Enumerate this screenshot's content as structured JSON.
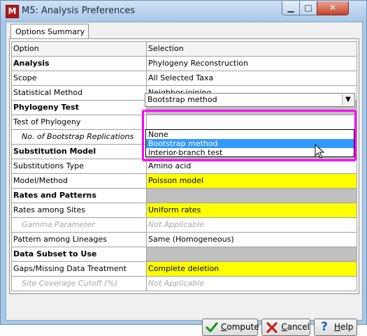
{
  "window": {
    "title": "M5: Analysis Preferences",
    "icon_letter": "M",
    "minimize_glyph": "▁",
    "maximize_glyph": "□",
    "close_glyph": "✕"
  },
  "tab": {
    "label": "Options Summary"
  },
  "table": {
    "headers": {
      "option": "Option",
      "selection": "Selection"
    },
    "rows": [
      {
        "option": "Analysis",
        "selection": "Phylogeny Reconstruction",
        "style": "section-bold"
      },
      {
        "option": "Scope",
        "selection": "All Selected Taxa",
        "style": "normal"
      },
      {
        "option": "Statistical Method",
        "selection": "Neighbor-joining",
        "style": "normal"
      },
      {
        "option": "Phylogeny Test",
        "selection": "",
        "style": "section"
      },
      {
        "option": "Test of Phylogeny",
        "selection": "Bootstrap method",
        "style": "combo"
      },
      {
        "option": "No. of Bootstrap Replications",
        "selection": "",
        "style": "sub"
      },
      {
        "option": "Substitution Model",
        "selection": "",
        "style": "section"
      },
      {
        "option": "Substitutions Type",
        "selection": "Amino acid",
        "style": "normal"
      },
      {
        "option": "Model/Method",
        "selection": "Poisson model",
        "style": "yellow"
      },
      {
        "option": "Rates and Patterns",
        "selection": "",
        "style": "section"
      },
      {
        "option": "Rates among Sites",
        "selection": "Uniform rates",
        "style": "yellow"
      },
      {
        "option": "Gamma Parameter",
        "selection": "Not Applicable",
        "style": "disabled"
      },
      {
        "option": "Pattern among Lineages",
        "selection": "Same (Homogeneous)",
        "style": "normal"
      },
      {
        "option": "Data Subset to Use",
        "selection": "",
        "style": "section"
      },
      {
        "option": "Gaps/Missing Data Treatment",
        "selection": "Complete deletion",
        "style": "yellow"
      },
      {
        "option": "Site Coverage Cutoff (%)",
        "selection": "Not Applicable",
        "style": "disabled"
      }
    ]
  },
  "combo": {
    "value": "Bootstrap method",
    "options": [
      "None",
      "Bootstrap method",
      "Interior-branch test"
    ],
    "selected_index": 1
  },
  "buttons": {
    "compute": {
      "label_first": "C",
      "label_rest": "ompute"
    },
    "cancel": {
      "label_first": "C",
      "label_rest": "ancel"
    },
    "help": {
      "label_first": "H",
      "label_rest": "elp"
    }
  },
  "colors": {
    "highlight_box": "#ff00ff",
    "selected_option": "#3399ff",
    "required_field": "#ffff00",
    "section_band": "#c0c0c0"
  }
}
